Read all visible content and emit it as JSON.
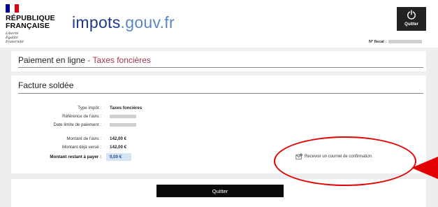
{
  "header": {
    "gov_name_line1": "RÉPUBLIQUE",
    "gov_name_line2": "FRANÇAISE",
    "motto": [
      "Liberté",
      "Égalité",
      "Fraternité"
    ],
    "brand_main": "impots",
    "brand_domain": ".gouv.fr",
    "quit_label": "Quitter",
    "fiscal_label": "N° fiscal :"
  },
  "section1": {
    "title_main": "Paiement en ligne",
    "title_sep": " - ",
    "title_accent": "Taxes foncières"
  },
  "section2": {
    "title": "Facture soldée",
    "rows": [
      {
        "label": "Type impôt :",
        "value": "Taxes foncières"
      },
      {
        "label": "Référence de l'avis :",
        "value": ""
      },
      {
        "label": "Date limite de paiement :",
        "value": ""
      },
      {
        "label": "Montant de l'avis :",
        "value": "142,00 €"
      },
      {
        "label": "Montant déjà versé :",
        "value": "142,00 €"
      }
    ],
    "remaining_label": "Montant restant à payer :",
    "remaining_value": "0,00 €",
    "confirm_link": "Recevoir un courriel de confirmation"
  },
  "footer": {
    "quit_label": "Quitter"
  },
  "colors": {
    "accent": "#a03a4e",
    "brand_blue": "#1e3a8a",
    "annotation_red": "#e30000",
    "highlight_blue": "#d5e3f3"
  }
}
